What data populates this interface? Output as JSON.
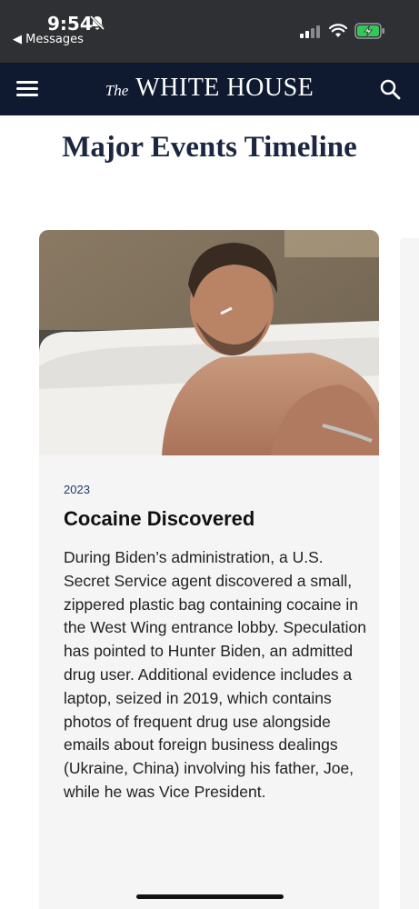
{
  "status_bar": {
    "time": "9:54",
    "back_label": "◀ Messages",
    "icons": [
      "bell-muted-icon",
      "cellular-signal-icon",
      "wifi-icon",
      "battery-charging-icon"
    ]
  },
  "header": {
    "brand_the": "The",
    "brand_name": "WHITE HOUSE",
    "icons": [
      "menu-icon",
      "search-icon"
    ]
  },
  "page": {
    "title": "Major Events Timeline"
  },
  "event": {
    "year": "2023",
    "title": "Cocaine Discovered",
    "description": "During Biden’s administration, a U.S. Secret Service agent discovered a small, zippered plastic bag containing cocaine in the West Wing entrance lobby. Speculation has pointed to Hunter Biden, an admitted drug user. Additional evidence includes a laptop, seized in 2019, which contains photos of frequent drug use alongside emails about foreign business dealings (Ukraine, China) involving his father, Joe, while he was Vice President."
  },
  "colors": {
    "status_bar_bg": "#2f3033",
    "nav_bg": "#0f1a31",
    "title_color": "#1c2640",
    "year_color": "#1f3a6b",
    "card_bg": "#f5f5f6"
  }
}
